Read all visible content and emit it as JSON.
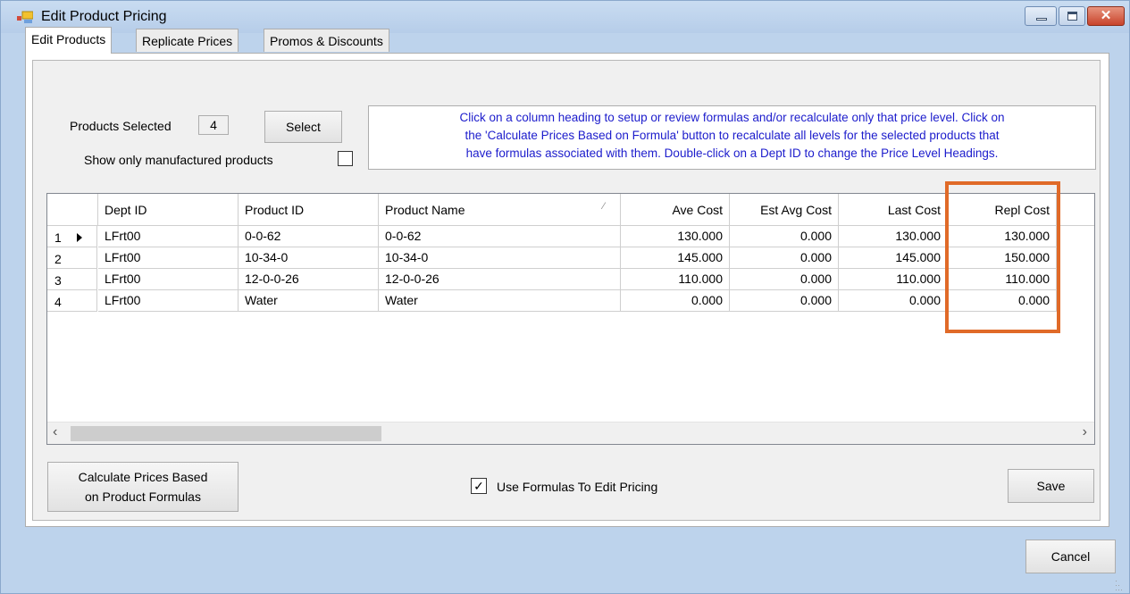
{
  "window": {
    "title": "Edit Product Pricing"
  },
  "tabs": [
    {
      "label": "Edit Products"
    },
    {
      "label": "Replicate Prices"
    },
    {
      "label": "Promos & Discounts"
    }
  ],
  "selection": {
    "products_selected_label": "Products Selected",
    "products_selected_value": "4",
    "select_button": "Select",
    "show_manufactured_label": "Show only manufactured products",
    "show_manufactured_checked": false
  },
  "info_text": {
    "line1": "Click on a column heading to setup or review formulas and/or recalculate only that price level. Click on",
    "line2": "the 'Calculate Prices Based on Formula' button to recalculate all levels for the selected products that",
    "line3": "have formulas associated with them. Double-click on a Dept ID to change the Price Level Headings."
  },
  "grid": {
    "columns": [
      "Dept ID",
      "Product ID",
      "Product Name",
      "Ave Cost",
      "Est Avg Cost",
      "Last Cost",
      "Repl Cost"
    ],
    "rows": [
      {
        "num": "1",
        "dept": "LFrt00",
        "pid": "0-0-62",
        "name": "0-0-62",
        "ave": "130.000",
        "est": "0.000",
        "last": "130.000",
        "repl": "130.000"
      },
      {
        "num": "2",
        "dept": "LFrt00",
        "pid": "10-34-0",
        "name": "10-34-0",
        "ave": "145.000",
        "est": "0.000",
        "last": "145.000",
        "repl": "150.000"
      },
      {
        "num": "3",
        "dept": "LFrt00",
        "pid": "12-0-0-26",
        "name": "12-0-0-26",
        "ave": "110.000",
        "est": "0.000",
        "last": "110.000",
        "repl": "110.000"
      },
      {
        "num": "4",
        "dept": "LFrt00",
        "pid": "Water",
        "name": "Water",
        "ave": "0.000",
        "est": "0.000",
        "last": "0.000",
        "repl": "0.000"
      }
    ]
  },
  "footer": {
    "calc_line1": "Calculate Prices Based",
    "calc_line2": "on Product Formulas",
    "use_formulas_label": "Use Formulas To Edit Pricing",
    "use_formulas_checked": true,
    "save_button": "Save",
    "cancel_button": "Cancel"
  },
  "colors": {
    "highlight": "#e06a28",
    "info_text": "#1c1ccc"
  }
}
